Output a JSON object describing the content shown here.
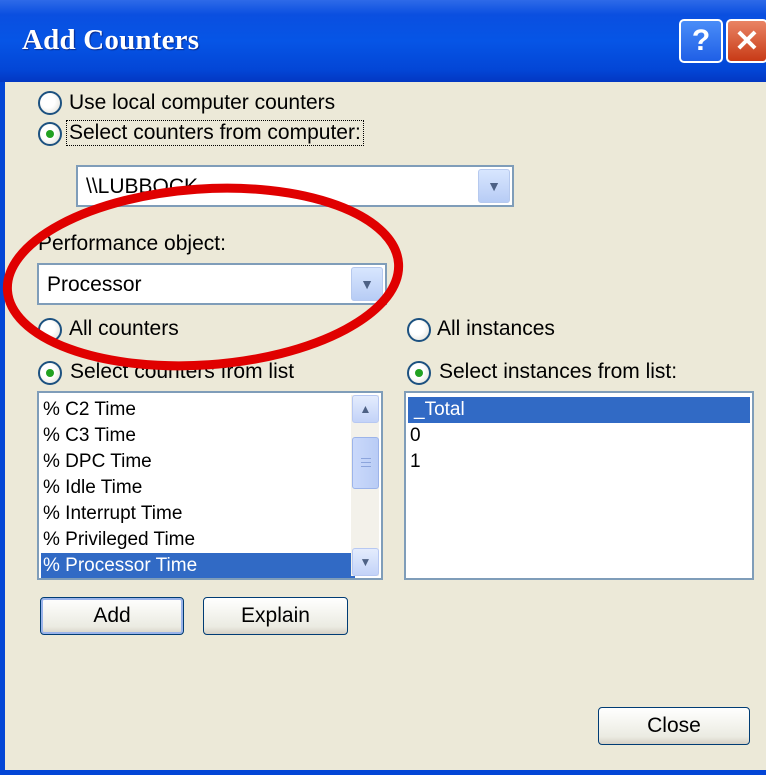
{
  "window": {
    "title": "Add Counters"
  },
  "titlebar_buttons": {
    "help": "?",
    "close": "✕"
  },
  "source": {
    "local_label": "Use local computer counters",
    "remote_label": "Select counters from computer:",
    "computer_value": "\\\\LUBBOCK"
  },
  "performance_object": {
    "label": "Performance object:",
    "value": "Processor"
  },
  "counters": {
    "all_label": "All counters",
    "list_label": "Select counters from list",
    "items": [
      "% C2 Time",
      "% C3 Time",
      "% DPC Time",
      "% Idle Time",
      "% Interrupt Time",
      "% Privileged Time",
      "% Processor Time"
    ],
    "selected": "% Processor Time"
  },
  "instances": {
    "all_label": "All instances",
    "list_label": "Select instances from list:",
    "items": [
      "_Total",
      "0",
      "1"
    ],
    "selected": "_Total"
  },
  "buttons": {
    "add": "Add",
    "explain": "Explain",
    "close": "Close"
  },
  "annotation": {
    "color": "#E00000"
  }
}
